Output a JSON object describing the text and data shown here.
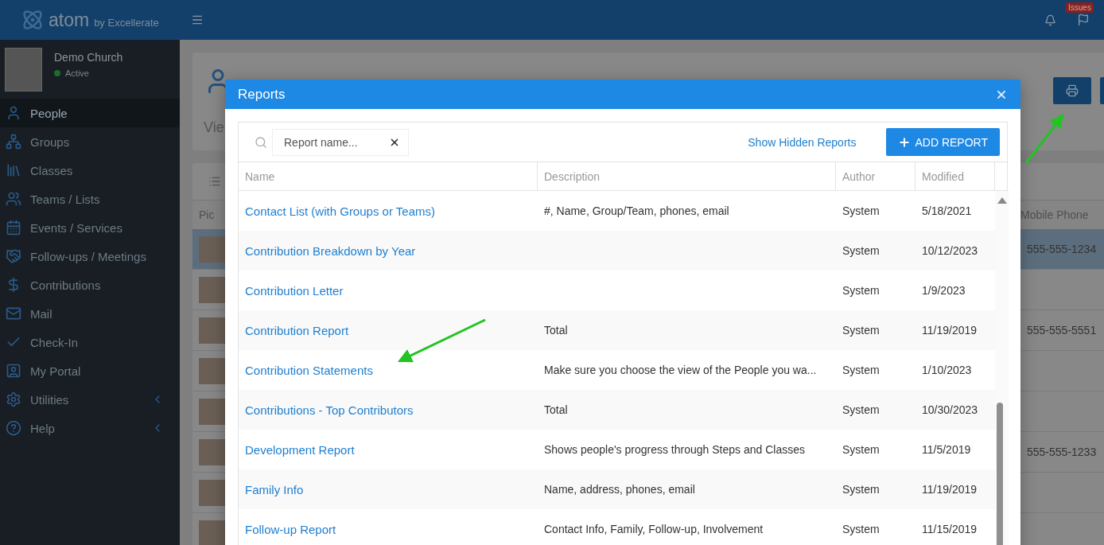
{
  "header": {
    "logo": "atom",
    "logo_suffix": "by Excellerate",
    "issues_badge": "Issues"
  },
  "account": {
    "name": "Demo Church",
    "status": "Active"
  },
  "sidebar": {
    "items": [
      {
        "label": "People",
        "selected": true,
        "has_submenu": false
      },
      {
        "label": "Groups",
        "selected": false,
        "has_submenu": false
      },
      {
        "label": "Classes",
        "selected": false,
        "has_submenu": false
      },
      {
        "label": "Teams / Lists",
        "selected": false,
        "has_submenu": false
      },
      {
        "label": "Events / Services",
        "selected": false,
        "has_submenu": false
      },
      {
        "label": "Follow-ups / Meetings",
        "selected": false,
        "has_submenu": false
      },
      {
        "label": "Contributions",
        "selected": false,
        "has_submenu": false
      },
      {
        "label": "Mail",
        "selected": false,
        "has_submenu": false
      },
      {
        "label": "Check-In",
        "selected": false,
        "has_submenu": false
      },
      {
        "label": "My Portal",
        "selected": false,
        "has_submenu": false
      },
      {
        "label": "Utilities",
        "selected": false,
        "has_submenu": true
      },
      {
        "label": "Help",
        "selected": false,
        "has_submenu": true
      }
    ]
  },
  "page": {
    "title": "Vie",
    "table": {
      "columns": [
        "Pic",
        "Mobile Phone"
      ],
      "rows": [
        {
          "mobile_phone": "555-555-1234",
          "selected": true
        },
        {
          "mobile_phone": "",
          "selected": false
        },
        {
          "mobile_phone": "555-555-5551",
          "selected": false
        },
        {
          "mobile_phone": "",
          "selected": false
        },
        {
          "mobile_phone": "",
          "selected": false
        },
        {
          "mobile_phone": "555-555-1233",
          "selected": false
        },
        {
          "mobile_phone": "",
          "selected": false
        },
        {
          "mobile_phone": "",
          "selected": false
        }
      ]
    }
  },
  "dialog": {
    "title": "Reports",
    "search": {
      "placeholder": "Report name..."
    },
    "show_hidden_link": "Show Hidden Reports",
    "add_button": "ADD REPORT",
    "columns": [
      "Name",
      "Description",
      "Author",
      "Modified"
    ],
    "rows": [
      {
        "name": "Contact List (with Groups or Teams)",
        "description": "#, Name, Group/Team, phones, email",
        "author": "System",
        "modified": "5/18/2021"
      },
      {
        "name": "Contribution Breakdown by Year",
        "description": "",
        "author": "System",
        "modified": "10/12/2023"
      },
      {
        "name": "Contribution Letter",
        "description": "",
        "author": "System",
        "modified": "1/9/2023"
      },
      {
        "name": "Contribution Report",
        "description": "Total",
        "author": "System",
        "modified": "11/19/2019"
      },
      {
        "name": "Contribution Statements",
        "description": "Make sure you choose the view of the People you wa...",
        "author": "System",
        "modified": "1/10/2023"
      },
      {
        "name": "Contributions - Top Contributors",
        "description": "Total",
        "author": "System",
        "modified": "10/30/2023"
      },
      {
        "name": "Development Report",
        "description": "Shows people's progress through Steps and Classes",
        "author": "System",
        "modified": "11/5/2019"
      },
      {
        "name": "Family Info",
        "description": "Name, address, phones, email",
        "author": "System",
        "modified": "11/19/2019"
      },
      {
        "name": "Follow-up Report",
        "description": "Contact Info, Family, Follow-up, Involvement",
        "author": "System",
        "modified": "11/15/2019"
      }
    ]
  }
}
